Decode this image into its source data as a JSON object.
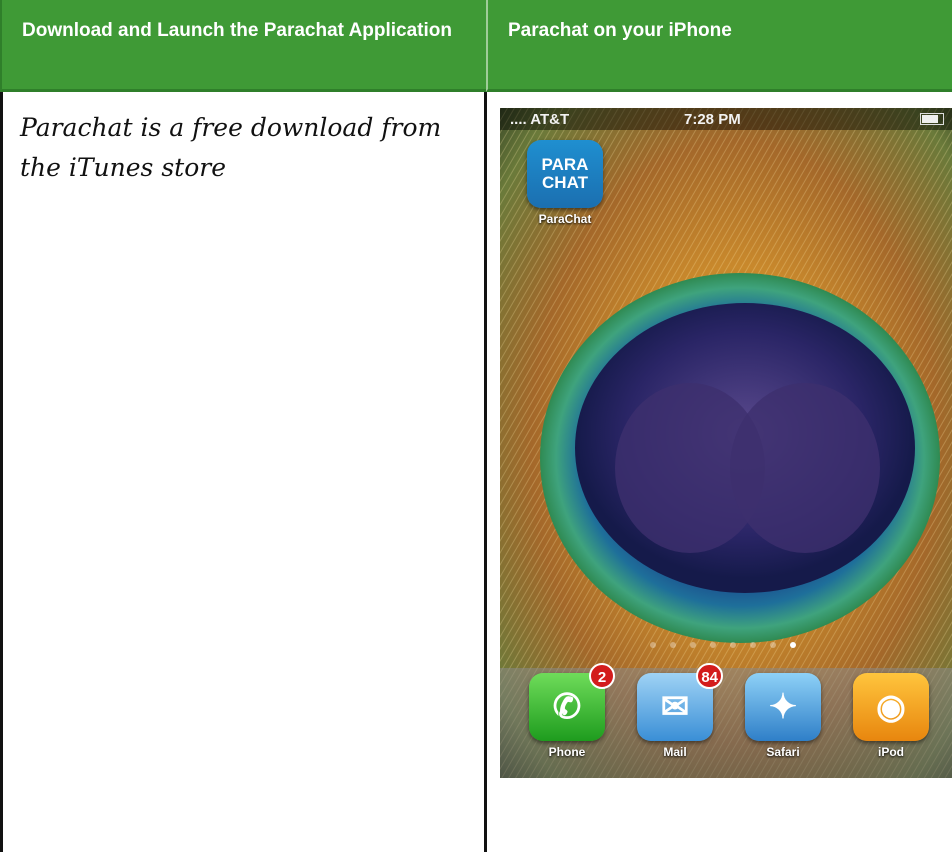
{
  "header": {
    "left_title": "Download and Launch the Parachat Application",
    "right_title": "Parachat on your iPhone"
  },
  "content": {
    "left_text": "Parachat is a free download from the iTunes store"
  },
  "phone": {
    "status": {
      "carrier": ".... AT&T",
      "time": "7:28 PM"
    },
    "apps": {
      "parachat_label": "ParaChat",
      "parachat_icon_text": "PARA CHAT"
    },
    "dock": [
      {
        "label": "Phone",
        "badge": "2",
        "icon": "phone-icon"
      },
      {
        "label": "Mail",
        "badge": "84",
        "icon": "mail-icon"
      },
      {
        "label": "Safari",
        "badge": "",
        "icon": "safari-icon"
      },
      {
        "label": "iPod",
        "badge": "",
        "icon": "ipod-icon"
      }
    ]
  }
}
